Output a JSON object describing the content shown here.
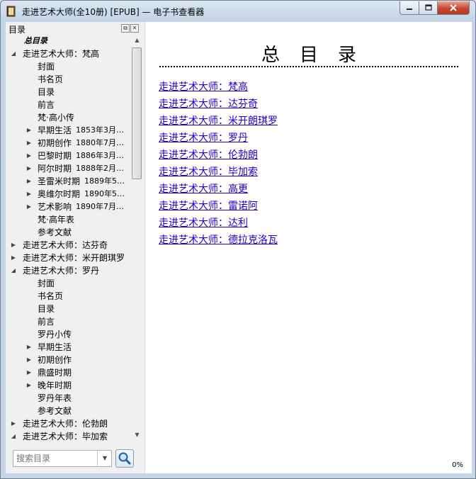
{
  "window": {
    "title": "走进艺术大师(全10册) [EPUB] — 电子书查看器"
  },
  "toc_panel": {
    "title": "目录",
    "search_placeholder": "搜索目录",
    "items": [
      {
        "label": "总目录",
        "level": 0,
        "arrow": "",
        "bold": true
      },
      {
        "label": "走进艺术大师：梵高",
        "level": 0,
        "arrow": "expanded"
      },
      {
        "label": "封面",
        "level": 1,
        "arrow": ""
      },
      {
        "label": "书名页",
        "level": 1,
        "arrow": ""
      },
      {
        "label": "目录",
        "level": 1,
        "arrow": ""
      },
      {
        "label": "前言",
        "level": 1,
        "arrow": ""
      },
      {
        "label": "梵·高小传",
        "level": 1,
        "arrow": ""
      },
      {
        "label": "早期生活",
        "sub": "1853年3月…",
        "level": 1,
        "arrow": "collapsed"
      },
      {
        "label": "初期创作",
        "sub": "1880年7月…",
        "level": 1,
        "arrow": "collapsed"
      },
      {
        "label": "巴黎时期",
        "sub": "1886年3月…",
        "level": 1,
        "arrow": "collapsed"
      },
      {
        "label": "阿尔时期",
        "sub": "1888年2月…",
        "level": 1,
        "arrow": "collapsed"
      },
      {
        "label": "圣雷米时期",
        "sub": "1889年5…",
        "level": 1,
        "arrow": "collapsed"
      },
      {
        "label": "奥维尔时期",
        "sub": "1890年5…",
        "level": 1,
        "arrow": "collapsed"
      },
      {
        "label": "艺术影响",
        "sub": "1890年7月…",
        "level": 1,
        "arrow": "collapsed"
      },
      {
        "label": "梵·高年表",
        "level": 1,
        "arrow": ""
      },
      {
        "label": "参考文献",
        "level": 1,
        "arrow": ""
      },
      {
        "label": "走进艺术大师：达芬奇",
        "level": 0,
        "arrow": "collapsed"
      },
      {
        "label": "走进艺术大师：米开朗琪罗",
        "level": 0,
        "arrow": "collapsed"
      },
      {
        "label": "走进艺术大师：罗丹",
        "level": 0,
        "arrow": "expanded"
      },
      {
        "label": "封面",
        "level": 1,
        "arrow": ""
      },
      {
        "label": "书名页",
        "level": 1,
        "arrow": ""
      },
      {
        "label": "目录",
        "level": 1,
        "arrow": ""
      },
      {
        "label": "前言",
        "level": 1,
        "arrow": ""
      },
      {
        "label": "罗丹小传",
        "level": 1,
        "arrow": ""
      },
      {
        "label": "早期生活",
        "level": 1,
        "arrow": "collapsed"
      },
      {
        "label": "初期创作",
        "level": 1,
        "arrow": "collapsed"
      },
      {
        "label": "鼎盛时期",
        "level": 1,
        "arrow": "collapsed"
      },
      {
        "label": "晚年时期",
        "level": 1,
        "arrow": "collapsed"
      },
      {
        "label": "罗丹年表",
        "level": 1,
        "arrow": ""
      },
      {
        "label": "参考文献",
        "level": 1,
        "arrow": ""
      },
      {
        "label": "走进艺术大师：伦勃朗",
        "level": 0,
        "arrow": "collapsed"
      },
      {
        "label": "走进艺术大师：毕加索",
        "level": 0,
        "arrow": "expanded"
      }
    ]
  },
  "content": {
    "heading": "总目录",
    "links": [
      "走进艺术大师：梵高",
      "走进艺术大师：达芬奇",
      "走进艺术大师：米开朗琪罗",
      "走进艺术大师：罗丹",
      "走进艺术大师：伦勃朗",
      "走进艺术大师：毕加索",
      "走进艺术大师：高更",
      "走进艺术大师：雷诺阿",
      "走进艺术大师：达利",
      "走进艺术大师：德拉克洛瓦"
    ],
    "progress": "0%"
  },
  "colors": {
    "link": "#1a00c8",
    "close_button": "#c6452f"
  }
}
